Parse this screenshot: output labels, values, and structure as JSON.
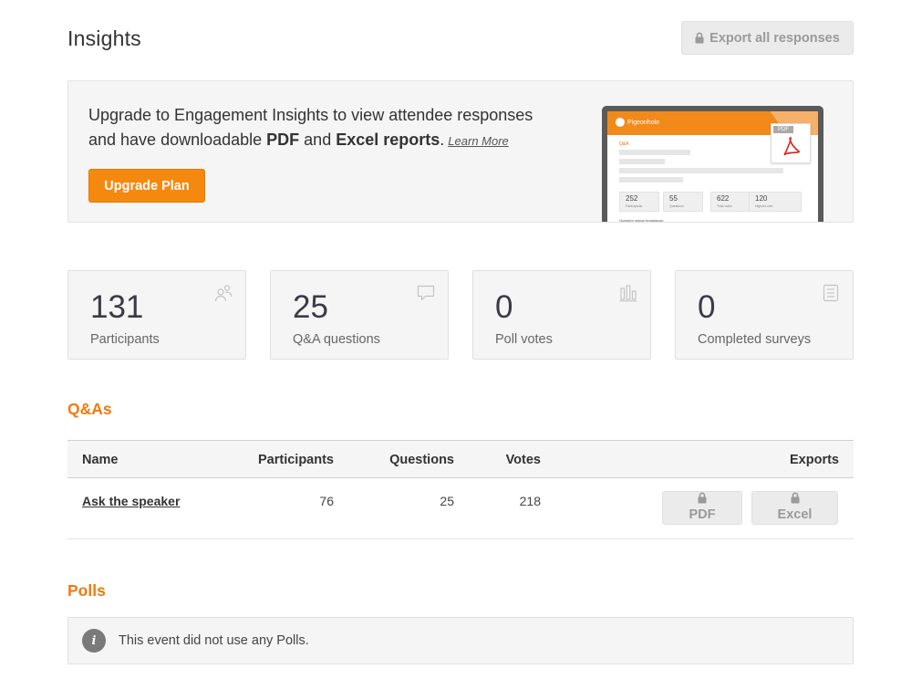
{
  "header": {
    "title": "Insights",
    "export_all_label": "Export all responses"
  },
  "banner": {
    "text_1": "Upgrade to Engagement Insights to view attendee responses and have downloadable ",
    "pdf": "PDF",
    "and": " and ",
    "excel": "Excel reports",
    "period": ".",
    "learn_more": "Learn More",
    "upgrade_label": "Upgrade Plan",
    "preview": {
      "logo": "Pigeonhole",
      "section": "Q&A",
      "pdf_tag": "PDF",
      "stats": [
        {
          "value": "252",
          "label": "Participants"
        },
        {
          "value": "55",
          "label": "Questions"
        },
        {
          "value": "622",
          "label": "Total votes"
        },
        {
          "value": "120",
          "label": "Highest vote"
        }
      ],
      "footer": "Question status breakdown"
    }
  },
  "stats": [
    {
      "value": "131",
      "label": "Participants",
      "icon": "participants-icon"
    },
    {
      "value": "25",
      "label": "Q&A questions",
      "icon": "chat-bubble-icon"
    },
    {
      "value": "0",
      "label": "Poll votes",
      "icon": "bar-chart-icon"
    },
    {
      "value": "0",
      "label": "Completed surveys",
      "icon": "clipboard-list-icon"
    }
  ],
  "qa": {
    "title": "Q&As",
    "columns": {
      "name": "Name",
      "participants": "Participants",
      "questions": "Questions",
      "votes": "Votes",
      "exports": "Exports"
    },
    "rows": [
      {
        "name": "Ask the speaker",
        "participants": "76",
        "questions": "25",
        "votes": "218",
        "pdf_label": "PDF",
        "excel_label": "Excel"
      }
    ]
  },
  "polls": {
    "title": "Polls",
    "notice_icon": "i",
    "notice": "This event did not use any Polls."
  },
  "colors": {
    "accent": "#f07a10",
    "button_orange": "#f5890f",
    "card_bg": "#f5f5f5"
  }
}
